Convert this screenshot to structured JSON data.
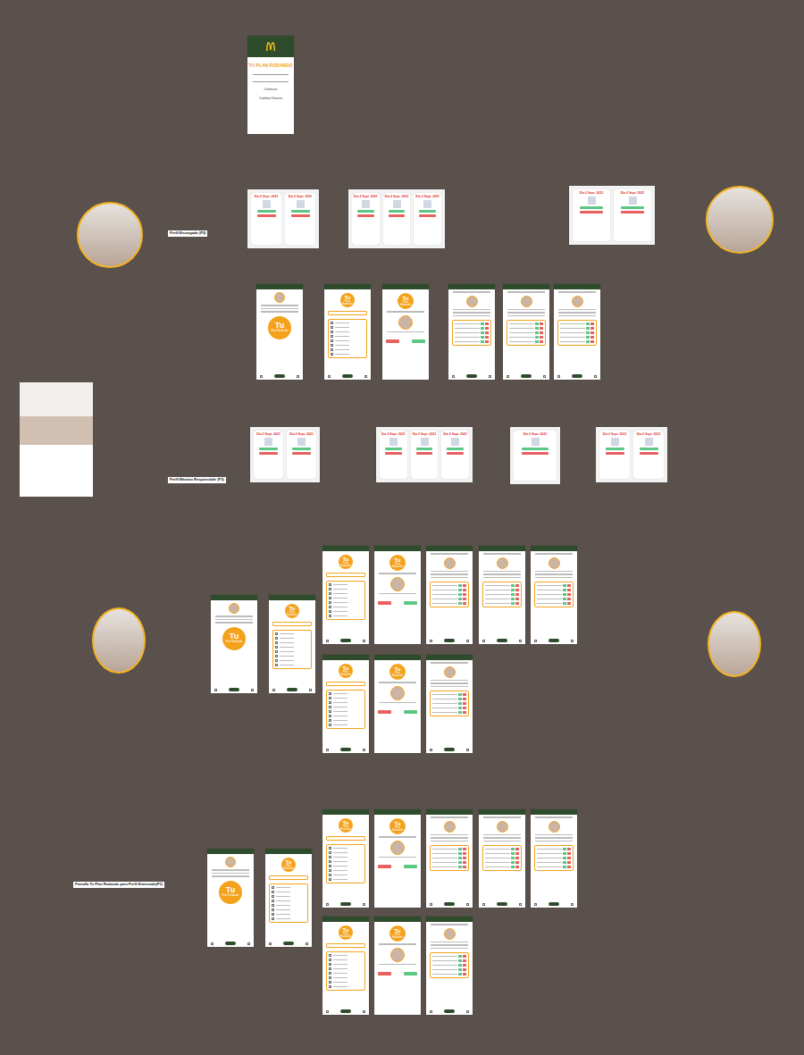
{
  "labels": [
    "Perfil Encargado (P2)",
    "Perfil Máximo Responsable (P3)",
    "Pantalla Tu Plan Rodando para Perfil Entrenado(P1)"
  ],
  "avatars": [
    {
      "ring": true
    },
    {
      "ring": true
    },
    {
      "ring": false
    },
    {
      "ring": true
    },
    {
      "ring": true
    }
  ],
  "frames": [
    {
      "kind": "login",
      "title": "TU PLAN RODANDO",
      "buttons": [
        "Continuar",
        "Cambiar Usuario"
      ]
    },
    {
      "kind": "board",
      "cards": [
        {
          "title": "Día 2 Sept. 2021"
        },
        {
          "title": "Día 2 Sept. 2021"
        }
      ]
    },
    {
      "kind": "board",
      "cards": [
        {
          "title": "Día 2 Sept. 2021"
        },
        {
          "title": "Día 2 Sept. 2021"
        },
        {
          "title": "Día 2 Sept. 2021"
        }
      ]
    },
    {
      "kind": "board",
      "cards": [
        {
          "title": "Día 2 Sept. 2021"
        },
        {
          "title": "Día 2 Sept. 2021"
        }
      ]
    },
    {
      "kind": "home",
      "logo": "Tu",
      "logo_sub": "Plan Rodando"
    },
    {
      "kind": "select",
      "logo": "Tu",
      "logo_sub": "Plan Rodando"
    },
    {
      "kind": "person",
      "logo": "Tu",
      "logo_sub": "Plan Rodando"
    },
    {
      "kind": "eval"
    },
    {
      "kind": "eval"
    },
    {
      "kind": "eval"
    },
    {
      "kind": "board",
      "cards": [
        {
          "title": "Día 2 Sept. 2021"
        },
        {
          "title": "Día 2 Sept. 2021"
        }
      ]
    },
    {
      "kind": "board",
      "cards": [
        {
          "title": "Día 2 Sept. 2021"
        },
        {
          "title": "Día 2 Sept. 2021"
        },
        {
          "title": "Día 2 Sept. 2021"
        }
      ]
    },
    {
      "kind": "board",
      "cards": [
        {
          "title": "Día 2 Sept. 2021"
        }
      ]
    },
    {
      "kind": "board",
      "cards": [
        {
          "title": "Día 2 Sept. 2021"
        },
        {
          "title": "Día 2 Sept. 2021"
        }
      ]
    },
    {
      "kind": "home",
      "logo": "Tu",
      "logo_sub": "Plan Rodando"
    },
    {
      "kind": "select",
      "logo": "Tu",
      "logo_sub": "Plan Rodando"
    },
    {
      "kind": "select",
      "logo": "Tu",
      "logo_sub": "Plan Rodando"
    },
    {
      "kind": "person",
      "logo": "Tu",
      "logo_sub": "Plan Rodando"
    },
    {
      "kind": "eval"
    },
    {
      "kind": "eval"
    },
    {
      "kind": "eval"
    },
    {
      "kind": "select",
      "logo": "Tu",
      "logo_sub": "Plan Rodando"
    },
    {
      "kind": "person",
      "logo": "Tu",
      "logo_sub": "Plan Rodando"
    },
    {
      "kind": "eval"
    },
    {
      "kind": "home",
      "logo": "Tu",
      "logo_sub": "Plan Rodando"
    },
    {
      "kind": "select",
      "logo": "Tu",
      "logo_sub": "Plan Rodando"
    },
    {
      "kind": "select",
      "logo": "Tu",
      "logo_sub": "Plan Rodando"
    },
    {
      "kind": "person",
      "logo": "Tu",
      "logo_sub": "Plan Rodando"
    },
    {
      "kind": "eval"
    },
    {
      "kind": "eval"
    },
    {
      "kind": "eval"
    },
    {
      "kind": "select",
      "logo": "Tu",
      "logo_sub": "Plan Rodando"
    },
    {
      "kind": "person",
      "logo": "Tu",
      "logo_sub": "Plan Rodando"
    },
    {
      "kind": "eval"
    }
  ]
}
